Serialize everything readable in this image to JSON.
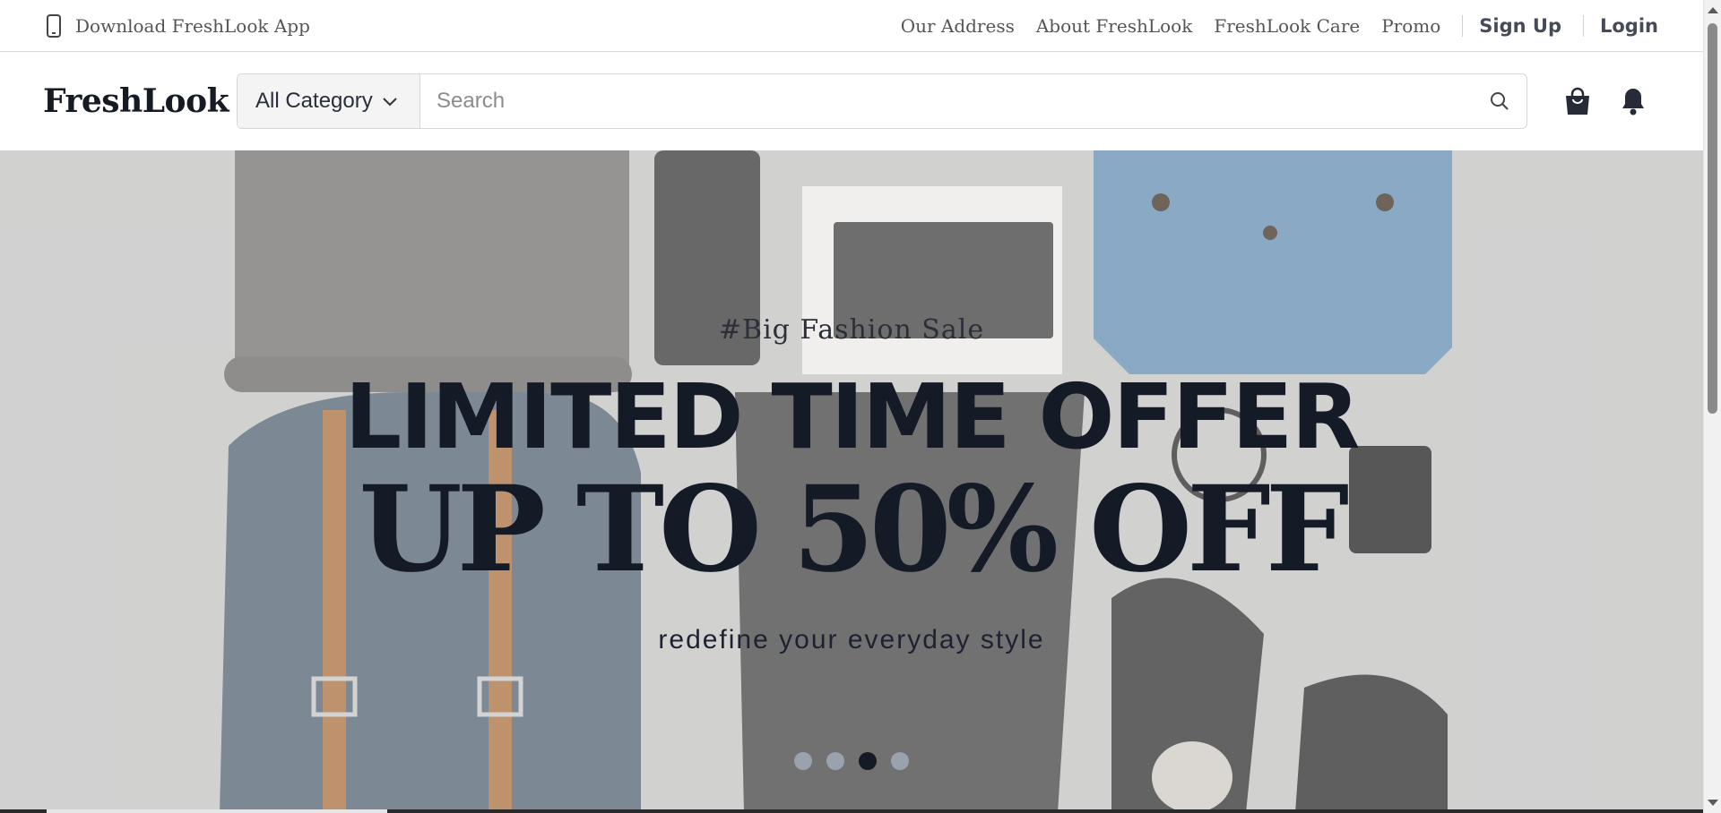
{
  "topbar": {
    "app_link": "Download FreshLook App",
    "nav": [
      "Our Address",
      "About FreshLook",
      "FreshLook Care",
      "Promo"
    ],
    "signup": "Sign Up",
    "login": "Login"
  },
  "header": {
    "logo": "FreshLook",
    "category": "All Category",
    "search_placeholder": "Search",
    "icons": [
      "shopping-bag-icon",
      "bell-icon"
    ]
  },
  "hero": {
    "tag": "#Big Fashion Sale",
    "headline": "LIMITED TIME OFFER",
    "subheadline": "UP TO 50% OFF",
    "tagline": "redefine your everyday style",
    "slides_total": 4,
    "active_slide": 3
  },
  "colors": {
    "accent_dark": "#141a26",
    "dot_inactive": "#9aa2ae"
  }
}
